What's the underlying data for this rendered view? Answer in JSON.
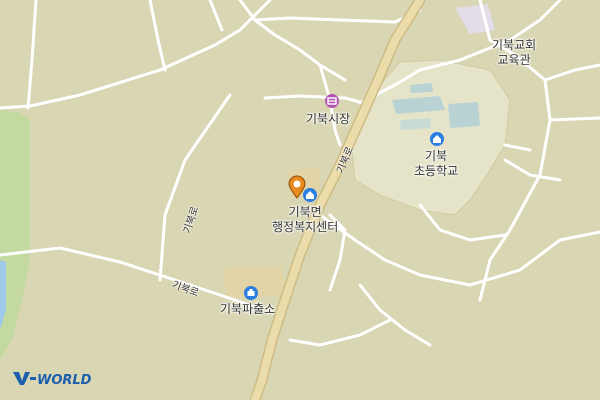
{
  "labels": {
    "church": [
      "기북교회",
      "교육관"
    ],
    "market": "기북시장",
    "school": [
      "기북",
      "초등학교"
    ],
    "office": [
      "기북면",
      "행정복지센터"
    ],
    "police": "기북파출소"
  },
  "roads": {
    "road_1": "기북로",
    "road_2": "기북로",
    "road_3": "기북로"
  },
  "logo": {
    "text": "V-WORLD"
  },
  "colors": {
    "land": "#d9d6b3",
    "field": "#e6e4c8",
    "main_road": "#e8d9a9",
    "minor_road": "#ffffff",
    "market_icon": "#b453b4",
    "school_icon": "#2a7de1",
    "office_icon": "#2a7de1",
    "police_icon": "#2a7de1",
    "marker": "#e88a1d",
    "water": "#9ec9e8",
    "park": "#b8d89a",
    "building": "#b9d3d5"
  },
  "icons": {
    "market": "market-icon",
    "school": "school-icon",
    "office": "government-office-icon",
    "police": "police-station-icon",
    "marker": "location-pin-icon"
  }
}
